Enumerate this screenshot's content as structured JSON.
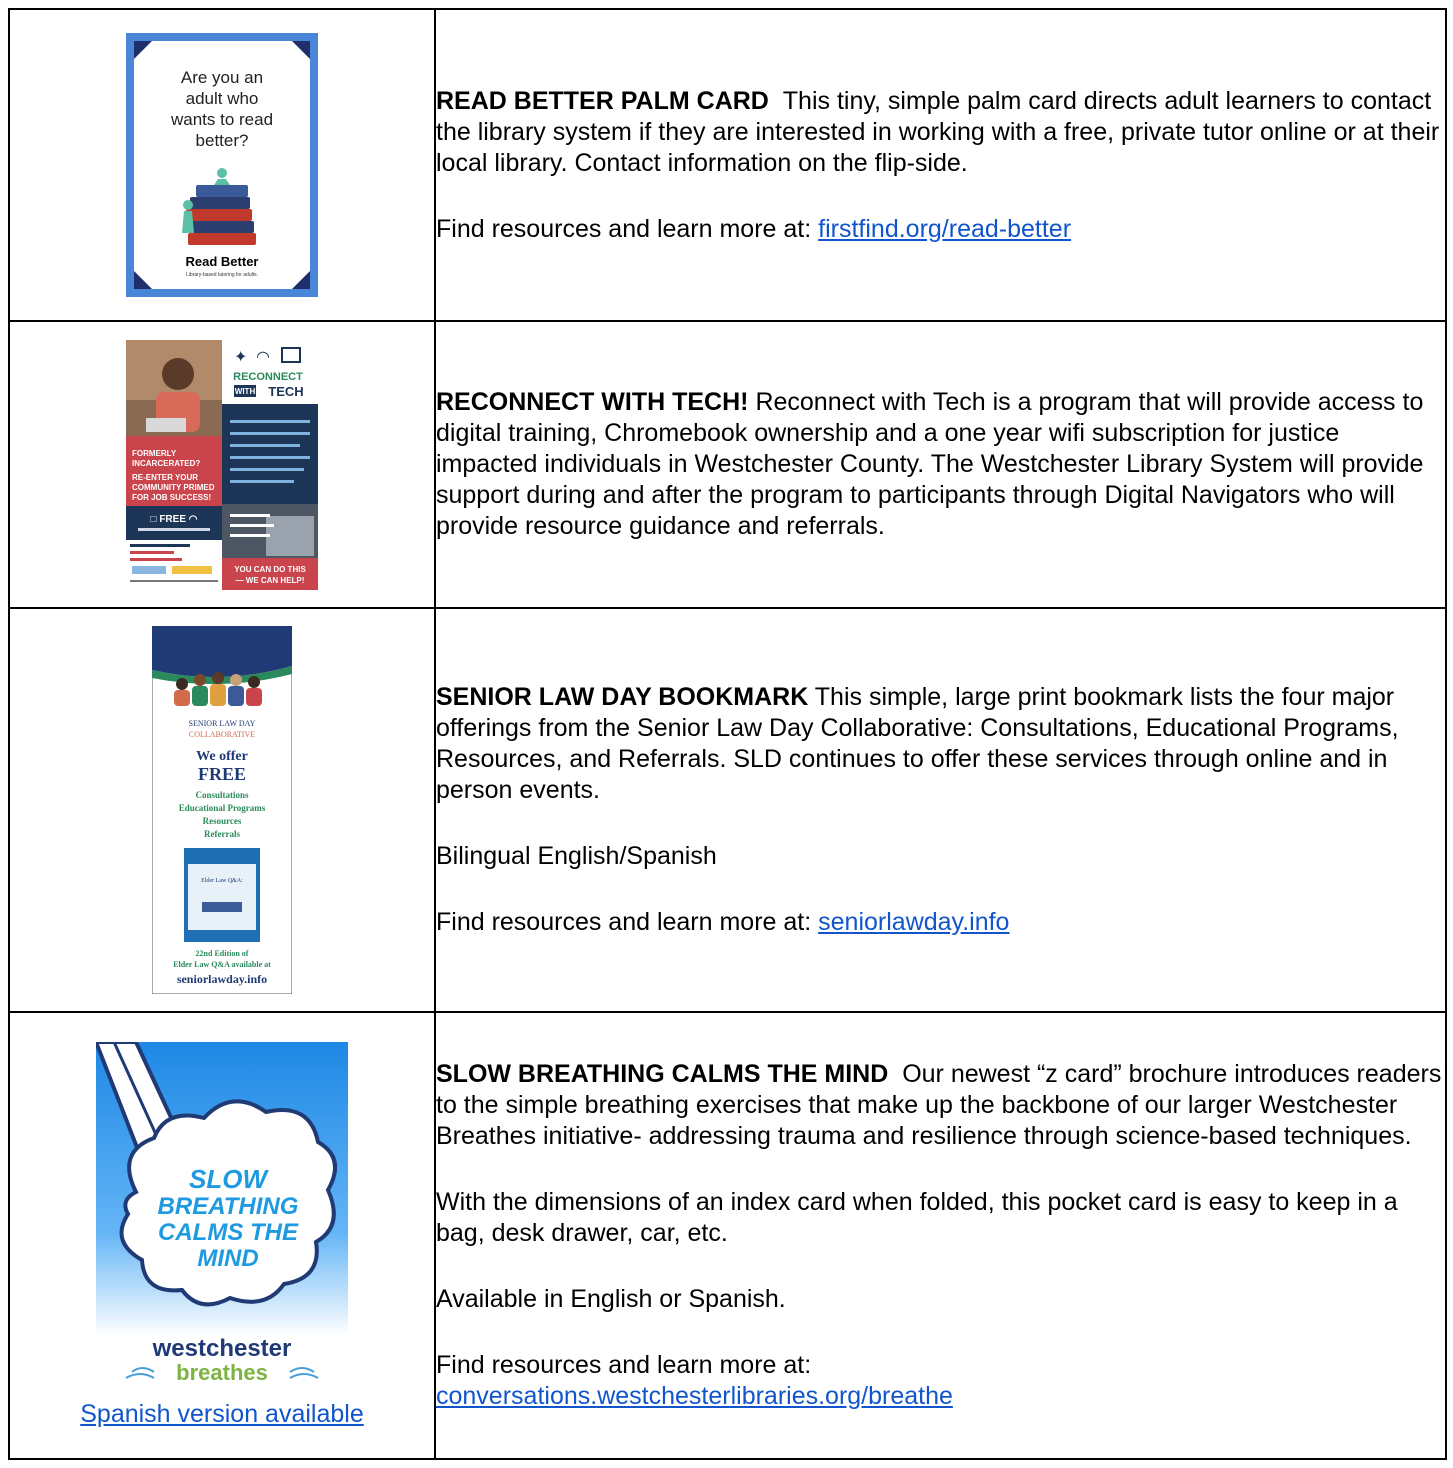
{
  "rows": [
    {
      "image": {
        "headline": "Are you an adult who wants to read better?",
        "brand": "Read Better",
        "tagline": "Library-based tutoring for adults."
      },
      "title": "READ BETTER PALM CARD",
      "body": "This tiny, simple palm card directs adult learners to contact the library system if they are interested in working with a free, private tutor online or at their local library. Contact information on the flip-side.",
      "find_text": "Find resources and learn more at: ",
      "link": "firstfind.org/read-better"
    },
    {
      "image": {
        "brand_line1": "RECONNECT",
        "brand_line2": "WITH",
        "brand_line3": "TECH",
        "red_text": "FORMERLY INCARCERATED? RE-ENTER YOUR COMMUNITY PRIMED FOR JOB SUCCESS!",
        "free_label": "FREE",
        "free_sub": "You're just 15 hours away from a FREE Chromebook & Hotspot!",
        "bullets": "• Earn a new Chromebook and a FREE hotspot with 12 months of unlimited WiFi! • Learn computer basics • Learn tech skills to stand out on job applications • Get connected to great online life resources! • Enjoy free refreshments!",
        "feeling": "Feeling behind in technology? Join this on-ramp class to learn basic tech skills!",
        "cta": "YOU CAN DO THIS — WE CAN HELP!",
        "contact": "FOR INFORMATION CONTACT: LINDA (914) 467-6697 LSMITH@WLSMAIL.ORG"
      },
      "title": "RECONNECT WITH TECH!",
      "body": "Reconnect with Tech is a program that will provide access to digital training, Chromebook ownership and a one year wifi subscription for justice impacted individuals in Westchester County. The Westchester Library System will provide support during and after the program to participants through Digital Navigators who will provide resource guidance and referrals."
    },
    {
      "image": {
        "org_line1": "SENIOR LAW DAY",
        "org_line2": "COLLABORATIVE",
        "offer": "We offer",
        "free": "FREE",
        "items": "Consultations Educational Programs Resources Referrals",
        "book_title": "Elder Law Q&A:",
        "edition_line": "22nd Edition of",
        "edition_line2": "Elder Law Q&A available at",
        "site": "seniorlawday.info"
      },
      "title": "SENIOR LAW DAY BOOKMARK",
      "body": "This simple, large print bookmark lists the four major offerings from the Senior Law Day Collaborative: Consultations, Educational Programs, Resources, and Referrals. SLD continues to offer these services through online and in person events.",
      "extra": "Bilingual English/Spanish",
      "find_text": "Find resources and learn more at: ",
      "link": "seniorlawday.info"
    },
    {
      "image": {
        "cloud_l1": "SLOW",
        "cloud_l2": "BREATHING",
        "cloud_l3": "CALMS THE",
        "cloud_l4": "MIND",
        "brand1": "westchester",
        "brand2": "breathes"
      },
      "spanish_link": "Spanish version available",
      "title": "SLOW BREATHING CALMS THE MIND",
      "body": "Our newest “z card” brochure introduces readers to the simple breathing exercises that make up the backbone of our larger Westchester Breathes initiative- addressing trauma and resilience through science-based techniques.",
      "extra": "With the dimensions of an index card when folded, this pocket card is easy to keep in a bag, desk drawer, car, etc.",
      "extra2": "Available in English or Spanish.",
      "find_text": "Find resources and learn more at:",
      "link": "conversations.westchesterlibraries.org/breathe"
    }
  ],
  "colors": {
    "link": "#1155cc",
    "read_better_frame": "#4a86d8",
    "reconnect_red": "#c9444b",
    "reconnect_navy": "#1d3557",
    "sld_navy": "#1f3a75",
    "sld_green": "#2b8a5c",
    "breathe_blue": "#1e88e5"
  }
}
